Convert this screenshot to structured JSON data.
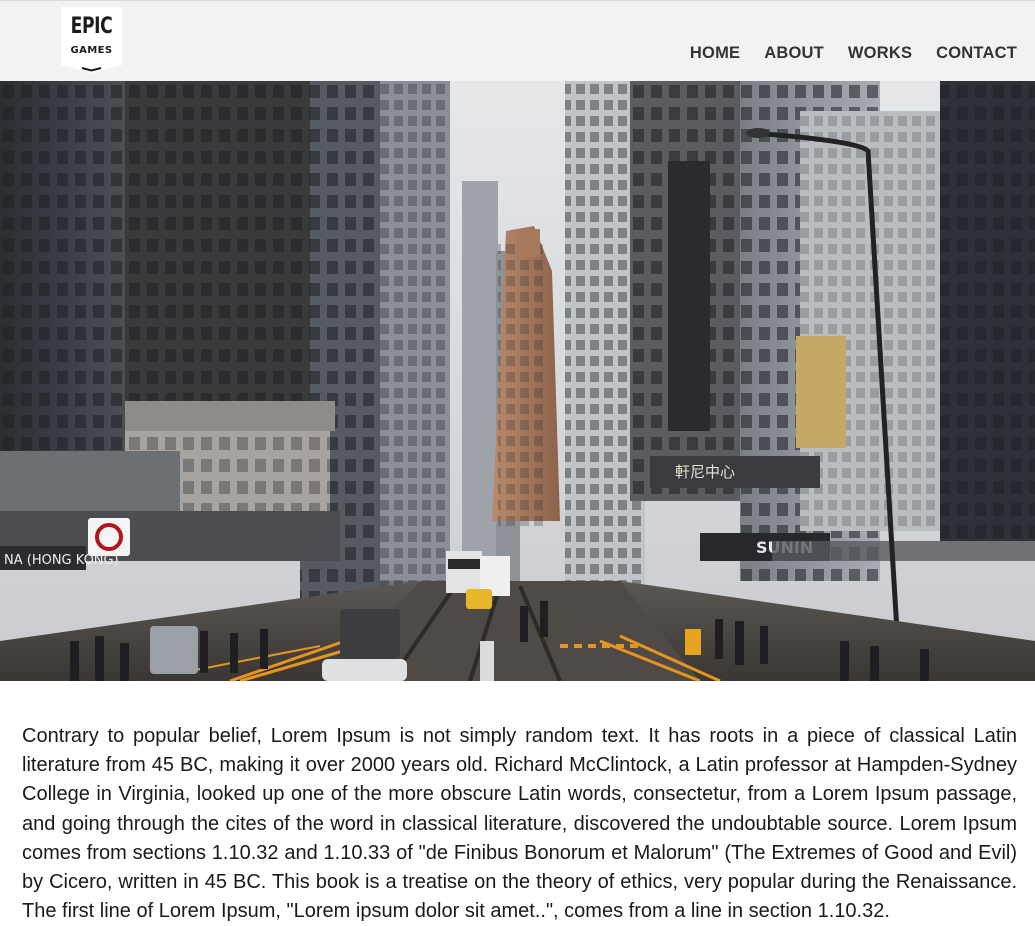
{
  "header": {
    "logo": {
      "line1": "EPIC",
      "line2": "GAMES",
      "icon": "epic-games-logo"
    },
    "nav": [
      {
        "label": "HOME"
      },
      {
        "label": "ABOUT"
      },
      {
        "label": "WORKS"
      },
      {
        "label": "CONTACT"
      }
    ]
  },
  "hero": {
    "icon": "city-street-photo",
    "signs": {
      "bank": "NA (HONG KONG)",
      "store": "SUNIN",
      "chinese": "軒尼中心"
    }
  },
  "main": {
    "paragraph": "Contrary to popular belief, Lorem Ipsum is not simply random text. It has roots in a piece of classical Latin literature from 45 BC, making it over 2000 years old. Richard McClintock, a Latin professor at Hampden-Sydney College in Virginia, looked up one of the more obscure Latin words, consectetur, from a Lorem Ipsum passage, and going through the cites of the word in classical literature, discovered the undoubtable source. Lorem Ipsum comes from sections 1.10.32 and 1.10.33 of \"de Finibus Bonorum et Malorum\" (The Extremes of Good and Evil) by Cicero, written in 45 BC. This book is a treatise on the theory of ethics, very popular during the Renaissance. The first line of Lorem Ipsum, \"Lorem ipsum dolor sit amet..\", comes from a line in section 1.10.32."
  },
  "colors": {
    "header_bg": "#f2f2f2",
    "nav_text": "#333333",
    "body_text": "#1a1a1a",
    "street_marking": "#e8951f"
  }
}
